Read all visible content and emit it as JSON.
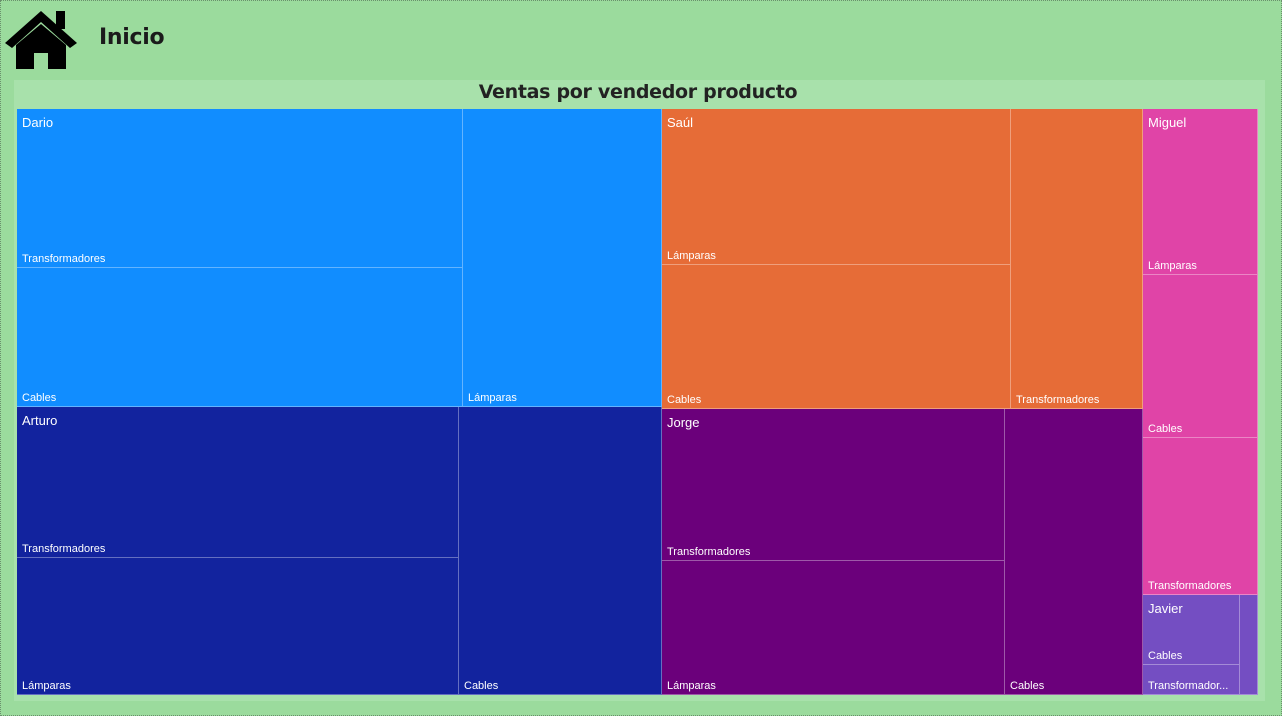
{
  "header": {
    "title": "Inicio",
    "icon": "home-icon"
  },
  "visual": {
    "title": "Ventas por vendedor producto"
  },
  "colors": {
    "Dario": "#118dff",
    "Arturo": "#12239e",
    "Saúl": "#e66c37",
    "Jorge": "#6b007b",
    "Miguel": "#e044a7",
    "Javier": "#744ec2",
    "page_background": "#9bdb9d",
    "visual_background": "#a8e1ab"
  },
  "treemap": {
    "groups": [
      "Dario",
      "Arturo",
      "Saúl",
      "Jorge",
      "Miguel",
      "Javier"
    ],
    "leaves": [
      {
        "vendedor": "Dario",
        "producto": "Transformadores"
      },
      {
        "vendedor": "Dario",
        "producto": "Cables"
      },
      {
        "vendedor": "Dario",
        "producto": "Lámparas"
      },
      {
        "vendedor": "Arturo",
        "producto": "Transformadores"
      },
      {
        "vendedor": "Arturo",
        "producto": "Lámparas"
      },
      {
        "vendedor": "Arturo",
        "producto": "Cables"
      },
      {
        "vendedor": "Saúl",
        "producto": "Lámparas"
      },
      {
        "vendedor": "Saúl",
        "producto": "Cables"
      },
      {
        "vendedor": "Saúl",
        "producto": "Transformadores"
      },
      {
        "vendedor": "Jorge",
        "producto": "Transformadores"
      },
      {
        "vendedor": "Jorge",
        "producto": "Lámparas"
      },
      {
        "vendedor": "Jorge",
        "producto": "Cables"
      },
      {
        "vendedor": "Miguel",
        "producto": "Lámparas"
      },
      {
        "vendedor": "Miguel",
        "producto": "Cables"
      },
      {
        "vendedor": "Miguel",
        "producto": "Transformadores"
      },
      {
        "vendedor": "Javier",
        "producto": "Cables"
      },
      {
        "vendedor": "Javier",
        "producto": "Transformador..."
      },
      {
        "vendedor": "Javier",
        "producto": ""
      }
    ]
  }
}
